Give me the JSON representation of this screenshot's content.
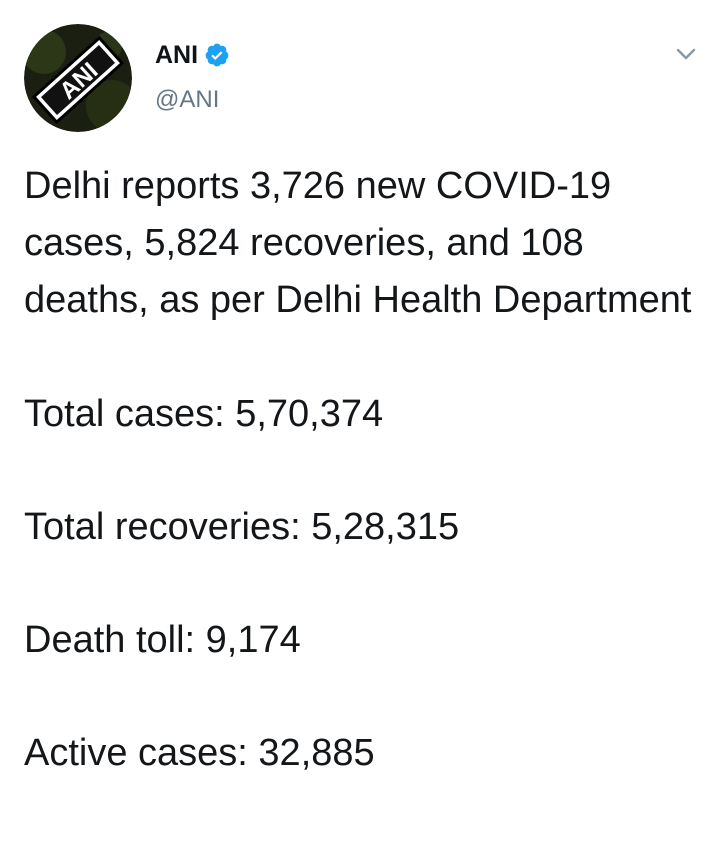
{
  "author": {
    "display_name": "ANI",
    "handle": "@ANI",
    "avatar_logo_text": "ANI",
    "verified": true,
    "verified_color": "#1DA1F2"
  },
  "menu": {
    "icon": "chevron-down-icon"
  },
  "tweet": {
    "headline": "Delhi reports 3,726 new COVID-19 cases, 5,824 recoveries, and 108 deaths, as per Delhi Health Department",
    "stats": [
      {
        "text": "Total cases: 5,70,374"
      },
      {
        "text": "Total recoveries: 5,28,315"
      },
      {
        "text": "Death toll: 9,174"
      },
      {
        "text": "Active cases: 32,885"
      }
    ]
  }
}
